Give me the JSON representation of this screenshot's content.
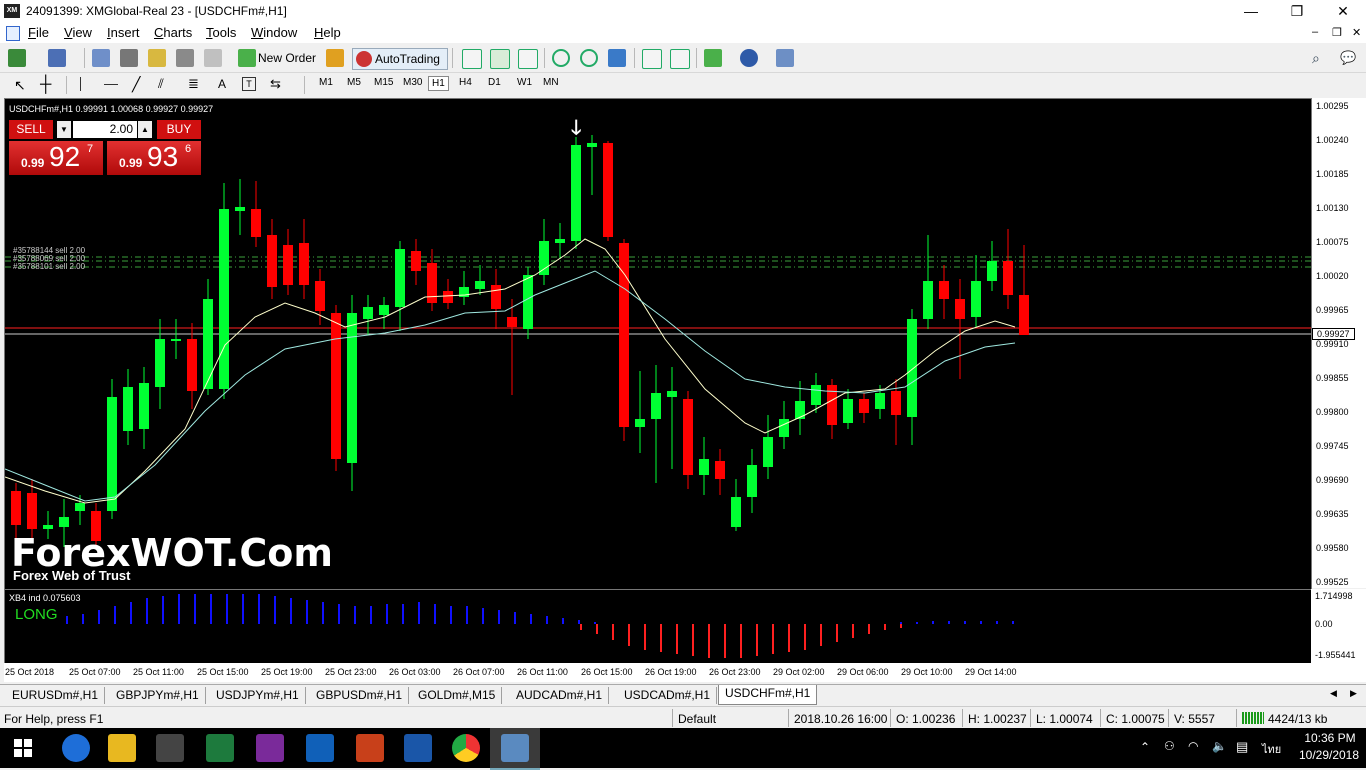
{
  "window": {
    "title": "24091399: XMGlobal-Real 23 - [USDCHFm#,H1]",
    "logo": "XM",
    "min_glyph": "—",
    "max_glyph": "❐",
    "close_glyph": "✕"
  },
  "menu": [
    "File",
    "View",
    "Insert",
    "Charts",
    "Tools",
    "Window",
    "Help"
  ],
  "toolbar": {
    "new_order": "New Order",
    "autotrading": "AutoTrading"
  },
  "timeframes": [
    "M1",
    "M5",
    "M15",
    "M30",
    "H1",
    "H4",
    "D1",
    "W1",
    "MN"
  ],
  "active_timeframe": "H1",
  "chart": {
    "header": "USDCHFm#,H1  0.99991 1.00068 0.99927 0.99927",
    "trade_panel": {
      "sell": "SELL",
      "buy": "BUY",
      "volume": "2.00",
      "sell_prefix": "0.99",
      "sell_big": "92",
      "sell_sup": "7",
      "buy_prefix": "0.99",
      "buy_big": "93",
      "buy_sup": "6"
    },
    "order_lines": [
      "#35788144 sell 2.00",
      "#35788069 sell 2.00",
      "#35788101 sell 2.00"
    ],
    "watermark_title": "ForexWOT.Com",
    "watermark_sub": "Forex Web of Trust",
    "price_labels": [
      "1.00295",
      "1.00240",
      "1.00185",
      "1.00130",
      "1.00075",
      "1.00020",
      "0.99965",
      "0.99927",
      "0.99910",
      "0.99855",
      "0.99800",
      "0.99745",
      "0.99690",
      "0.99635",
      "0.99580",
      "0.99525"
    ],
    "current_price": "0.99927",
    "time_labels": [
      "25 Oct 2018",
      "25 Oct 07:00",
      "25 Oct 11:00",
      "25 Oct 15:00",
      "25 Oct 19:00",
      "25 Oct 23:00",
      "26 Oct 03:00",
      "26 Oct 07:00",
      "26 Oct 11:00",
      "26 Oct 15:00",
      "26 Oct 19:00",
      "26 Oct 23:00",
      "29 Oct 02:00",
      "29 Oct 06:00",
      "29 Oct 10:00",
      "29 Oct 14:00"
    ]
  },
  "indicator": {
    "header": "XB4 ind 0.075603",
    "signal": "LONG",
    "labels": [
      "1.714998",
      "0.00",
      "-1.955441"
    ]
  },
  "tabs": [
    "EURUSDm#,H1",
    "GBPJPYm#,H1",
    "USDJPYm#,H1",
    "GBPUSDm#,H1",
    "GOLDm#,M15",
    "AUDCADm#,H1",
    "USDCADm#,H1",
    "USDCHFm#,H1"
  ],
  "active_tab": "USDCHFm#,H1",
  "status": {
    "help": "For Help, press F1",
    "profile": "Default",
    "datetime": "2018.10.26 16:00",
    "open": "O: 1.00236",
    "high": "H: 1.00237",
    "low": "L: 1.00074",
    "close": "C: 1.00075",
    "volume": "V: 5557",
    "traffic": "4424/13 kb"
  },
  "taskbar": {
    "time": "10:36 PM",
    "date": "10/29/2018",
    "lang": "ไทย"
  },
  "colors": {
    "bull": "#00ff33",
    "bear": "#ff0000",
    "ma_fast": "#ffffcc",
    "ma_slow": "#9fe8e0",
    "indicator_pos": "#1010ff",
    "indicator_neg": "#ff2020"
  }
}
